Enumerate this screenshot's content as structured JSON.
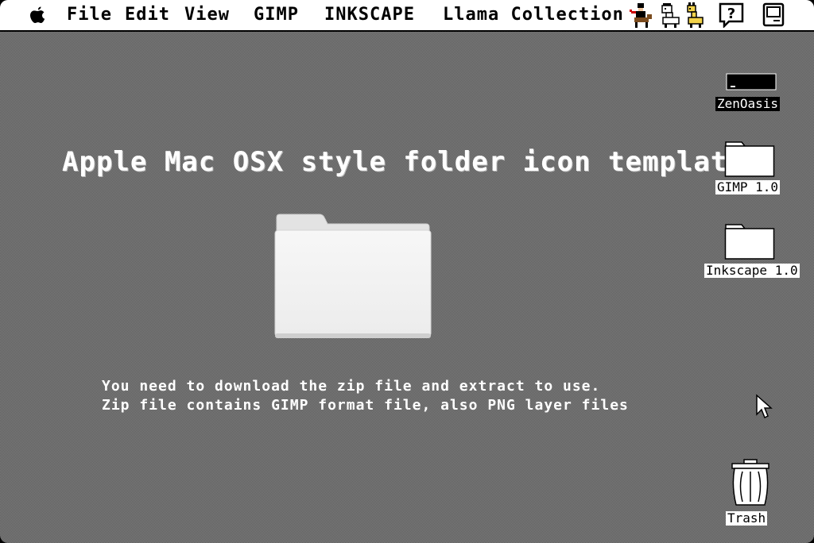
{
  "menubar": {
    "apple_icon": "apple-logo-icon",
    "items": [
      "File",
      "Edit",
      "View",
      "GIMP",
      "INKSCAPE",
      "Llama Collection"
    ],
    "right_icons": [
      "rider-figure-icon",
      "alpaca-icon",
      "llama-icon",
      "help-question-icon",
      "classic-mac-icon"
    ],
    "help_glyph": "?"
  },
  "main": {
    "headline": "Apple Mac OSX style folder icon template",
    "lines": [
      "You need to download the zip file and extract to use.",
      "Zip file contains GIMP format file, also PNG layer files"
    ]
  },
  "desktop": {
    "icons": [
      {
        "label": "ZenOasis",
        "icon": "disk-drive-icon",
        "selected": true
      },
      {
        "label": "GIMP 1.0",
        "icon": "folder-icon",
        "selected": false
      },
      {
        "label": "Inkscape 1.0",
        "icon": "folder-icon",
        "selected": false
      },
      {
        "label": "Trash",
        "icon": "trash-can-icon",
        "selected": false
      }
    ]
  },
  "colors": {
    "menubar_bg": "#ffffff",
    "desktop_pattern_dark": "#5c5c5c",
    "desktop_pattern_light": "#7f7f7f",
    "text_light": "#ffffff"
  }
}
